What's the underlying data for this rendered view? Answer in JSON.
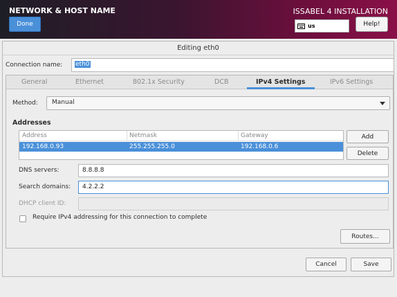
{
  "header": {
    "title": "NETWORK & HOST NAME",
    "done_label": "Done",
    "install_title": "ISSABEL 4 INSTALLATION",
    "keyboard_layout": "us",
    "help_label": "Help!",
    "gradient_colors": [
      "#1e1e26",
      "#6a0f3c",
      "#8a1048"
    ]
  },
  "dialog": {
    "title": "Editing eth0",
    "connection_name_label": "Connection name:",
    "connection_name_value": "eth0",
    "tabs": [
      {
        "label": "General"
      },
      {
        "label": "Ethernet"
      },
      {
        "label": "802.1x Security"
      },
      {
        "label": "DCB"
      },
      {
        "label": "IPv4 Settings",
        "active": true
      },
      {
        "label": "IPv6 Settings"
      }
    ],
    "method_label": "Method:",
    "method_value": "Manual",
    "addresses": {
      "title": "Addresses",
      "columns": [
        "Address",
        "Netmask",
        "Gateway"
      ],
      "rows": [
        {
          "address": "192.168.0.93",
          "netmask": "255.255.255.0",
          "gateway": "192.168.0.6"
        }
      ],
      "add_label": "Add",
      "delete_label": "Delete"
    },
    "dns_label": "DNS servers:",
    "dns_value": "8.8.8.8",
    "search_label": "Search domains:",
    "search_value": "4.2.2.2",
    "dhcp_label": "DHCP client ID:",
    "dhcp_value": "",
    "require_label": "Require IPv4 addressing for this connection to complete",
    "routes_label": "Routes...",
    "cancel_label": "Cancel",
    "save_label": "Save",
    "accent_color": "#4a90d9"
  }
}
